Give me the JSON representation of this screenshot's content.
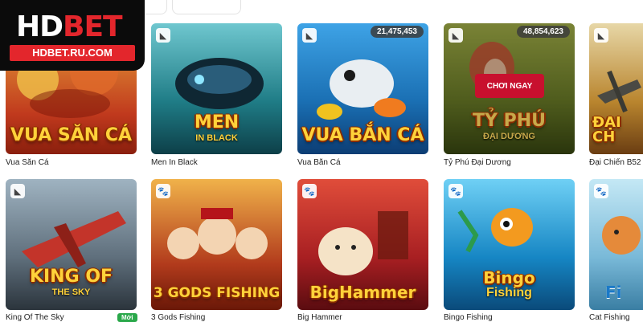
{
  "logo": {
    "part1": "HD",
    "part2": "BET",
    "url": "HDBET.RU.COM"
  },
  "row1": [
    {
      "name": "Vua Săn Cá",
      "art_title": "VUA SĂN CÁ",
      "bg": "#c0391d"
    },
    {
      "name": "Men In Black",
      "art_title": "MEN",
      "art_sub": "IN BLACK",
      "bg": "#1f7c86"
    },
    {
      "name": "Vua Bắn Cá",
      "art_title": "VUA BẮN CÁ",
      "jackpot": "21,475,453",
      "bg": "#1a6fb3"
    },
    {
      "name": "Tỷ Phú Đại Dương",
      "art_title": "TỶ PHÚ",
      "art_sub": "ĐẠI DƯƠNG",
      "jackpot": "48,854,623",
      "play_label": "CHƠI NGAY",
      "bg": "#6d7f28"
    },
    {
      "name": "Đại Chiến B52",
      "art_title": "ĐẠI CH",
      "bg": "#b9852e"
    }
  ],
  "row2": [
    {
      "name": "King Of The Sky",
      "art_title": "KING OF",
      "art_sub": "THE SKY",
      "tag": "Mới",
      "bg": "#5f6f7c"
    },
    {
      "name": "3 Gods Fishing",
      "art_title": "3 GODS FISHING",
      "bg": "#b23b1c"
    },
    {
      "name": "Big Hammer",
      "art_title": "BigHammer",
      "bg": "#a81f22"
    },
    {
      "name": "Bingo Fishing",
      "art_title": "Bingo",
      "art_sub": "Fishing",
      "bg": "#1686c4"
    },
    {
      "name": "Cat Fishing",
      "art_title": "Fi",
      "bg": "#79b9d8"
    }
  ]
}
